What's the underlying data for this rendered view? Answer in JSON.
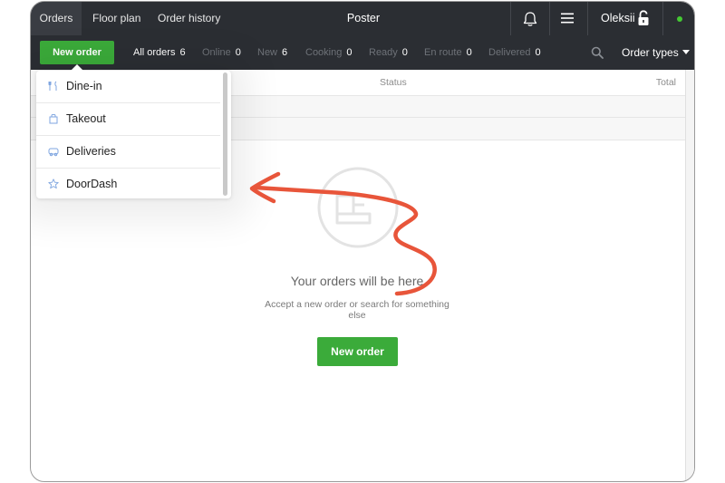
{
  "topbar": {
    "tabs": [
      {
        "label": "Orders",
        "active": true
      },
      {
        "label": "Floor plan",
        "active": false
      },
      {
        "label": "Order history",
        "active": false
      }
    ],
    "app_title": "Poster",
    "user_name": "Oleksii",
    "icons": [
      "bell-icon",
      "menu-icon",
      "unlocked-lock-icon",
      "online-status-dot"
    ]
  },
  "filterbar": {
    "new_order_label": "New order",
    "filters": [
      {
        "label": "All orders",
        "count": "6",
        "active": true
      },
      {
        "label": "Online",
        "count": "0",
        "active": false
      },
      {
        "label": "New",
        "count": "6",
        "active": false
      },
      {
        "label": "Cooking",
        "count": "0",
        "active": false
      },
      {
        "label": "Ready",
        "count": "0",
        "active": false
      },
      {
        "label": "En route",
        "count": "0",
        "active": false
      },
      {
        "label": "Delivered",
        "count": "0",
        "active": false
      }
    ],
    "order_types_label": "Order types"
  },
  "table": {
    "headers": {
      "status": "Status",
      "total": "Total"
    }
  },
  "dropdown": {
    "items": [
      {
        "label": "Dine-in",
        "icon": "dine-in-icon"
      },
      {
        "label": "Takeout",
        "icon": "takeout-bag-icon"
      },
      {
        "label": "Deliveries",
        "icon": "delivery-icon"
      },
      {
        "label": "DoorDash",
        "icon": "star-icon"
      }
    ]
  },
  "empty_state": {
    "title": "Your orders will be here",
    "subtitle": "Accept a new order or search for something else",
    "button_label": "New order"
  },
  "colors": {
    "topbar_bg": "#2b2e33",
    "accent_green": "#3bab3a",
    "annotation_arrow": "#e8553a",
    "status_online": "#44c933"
  }
}
